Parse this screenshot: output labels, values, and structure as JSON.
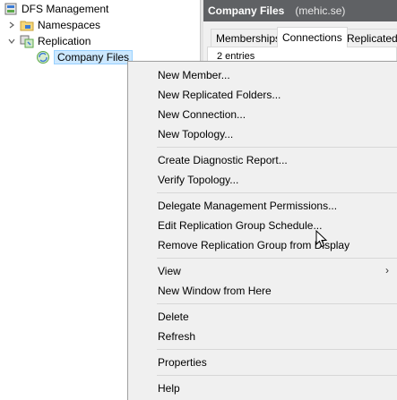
{
  "tree": {
    "root": "DFS Management",
    "namespaces": "Namespaces",
    "replication": "Replication",
    "company_files": "Company Files"
  },
  "pane": {
    "title": "Company Files",
    "server": "(mehic.se)",
    "tabs": [
      "Memberships",
      "Connections",
      "Replicated F"
    ],
    "active_tab": "Connections",
    "entries": "2 entries"
  },
  "menu": {
    "items": [
      "New Member...",
      "New Replicated Folders...",
      "New Connection...",
      "New Topology...",
      "Create Diagnostic Report...",
      "Verify Topology...",
      "Delegate Management Permissions...",
      "Edit Replication Group Schedule...",
      "Remove Replication Group from Display",
      "View",
      "New Window from Here",
      "Delete",
      "Refresh",
      "Properties",
      "Help"
    ],
    "submenu_arrow": "›"
  },
  "colors": {
    "header_bg": "#5f6164",
    "selection_bg": "#cce8ff",
    "menu_bg": "#f0f0f0"
  }
}
